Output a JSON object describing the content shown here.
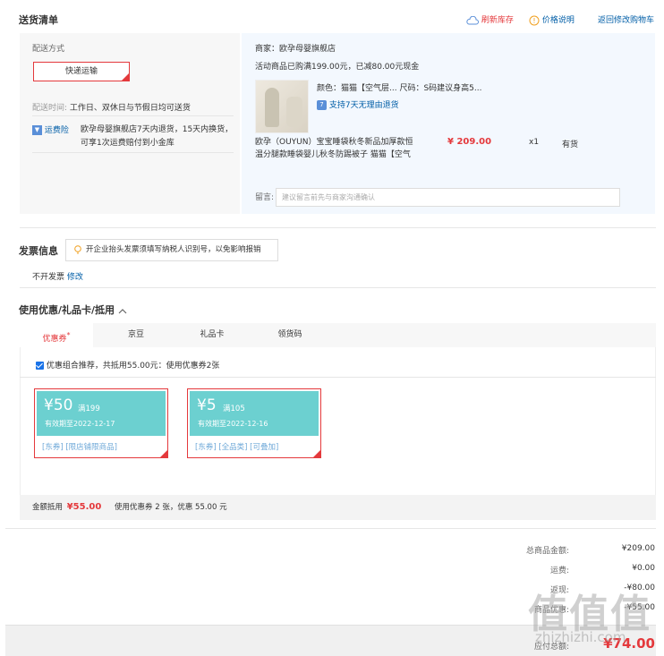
{
  "header": {
    "title": "送货清单",
    "refresh_stock": "刷新库存",
    "price_info": "价格说明",
    "back_to_cart": "返回修改购物车"
  },
  "shipping": {
    "method_label": "配送方式",
    "method_value": "快递运输",
    "time_label": "配送时间:",
    "time_value": "工作日、双休日与节假日均可送货",
    "freight_badge": "运费险",
    "freight_text_1": "欧孕母婴旗舰店7天内退货，15天内换货，",
    "freight_text_2": "可享1次运费赔付到小金库"
  },
  "store": {
    "merchant": "商家：欧孕母婴旗舰店",
    "promo": "活动商品已购满199.00元，已减80.00元现金",
    "product_attrs": "颜色：猫猫【空气层... 尺码：S码建议身高5...",
    "return_badge": "7",
    "return_policy": "支持7天无理由退货",
    "product_title_1": "欧孕（OUYUN）宝宝睡袋秋冬新品加厚款恒",
    "product_title_2": "温分腿款睡袋婴儿秋冬防踢被子 猫猫【空气",
    "price": "¥ 209.00",
    "qty": "x1",
    "stock": "有货",
    "remark_label": "留言:",
    "remark_placeholder": "建议留言前先与商家沟通确认"
  },
  "invoice": {
    "title": "发票信息",
    "tip": "开企业抬头发票须填写纳税人识别号，以免影响报销",
    "status": "不开发票",
    "modify": "修改"
  },
  "coupons": {
    "title": "使用优惠/礼品卡/抵用",
    "tabs": [
      "优惠券",
      "京豆",
      "礼品卡",
      "领货码"
    ],
    "tab_mark": "*",
    "combo_text": "优惠组合推荐，共抵用55.00元：使用优惠券2张",
    "list": [
      {
        "amount": "¥50",
        "condition": "满199",
        "expiry": "有效期至2022-12-17",
        "tags": "[东券] [限店铺限商品]"
      },
      {
        "amount": "¥5",
        "condition": "满105",
        "expiry": "有效期至2022-12-16",
        "tags": "[东券] [全品类] [可叠加]"
      }
    ],
    "deduct_label": "金额抵用",
    "deduct_amount": "¥55.00",
    "deduct_summary": "使用优惠券 2 张，优惠 55.00 元"
  },
  "summary": {
    "rows": [
      {
        "label": "总商品金额:",
        "value": "¥209.00"
      },
      {
        "label": "运费:",
        "value": "¥0.00"
      },
      {
        "label": "返现:",
        "value": "-¥80.00"
      },
      {
        "label": "商品优惠:",
        "value": "-¥55.00"
      }
    ],
    "total_label": "应付总额:",
    "total_value": "¥74.00"
  },
  "watermark": {
    "main": "值值值",
    "sub": "zhizhizhi.com"
  },
  "colors": {
    "accent_red": "#e4393c",
    "link_blue": "#005ea7",
    "coupon_teal": "#6cd0d0"
  }
}
